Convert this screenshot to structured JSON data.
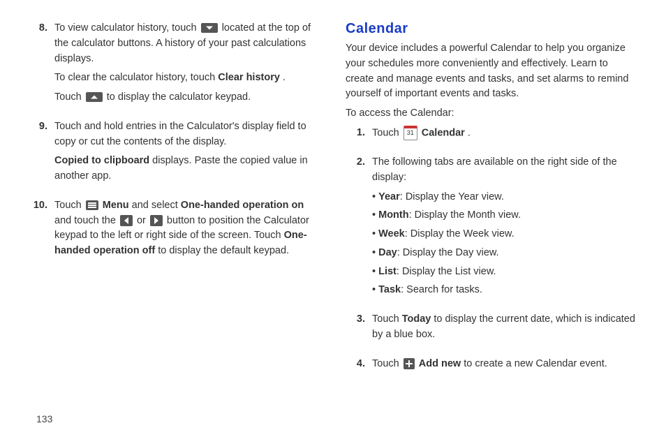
{
  "page_number": "133",
  "left": {
    "step8": {
      "num": "8.",
      "p1_a": "To view calculator history, touch ",
      "p1_b": " located at the top of the calculator buttons. A history of your past calculations displays.",
      "p2_a": "To clear the calculator history, touch ",
      "p2_b": "Clear history",
      "p2_c": ".",
      "p3_a": "Touch ",
      "p3_b": " to display the calculator keypad."
    },
    "step9": {
      "num": "9.",
      "p1": "Touch and hold entries in the Calculator's display field to copy or cut the contents of the display.",
      "p2_a": "Copied to clipboard",
      "p2_b": " displays. Paste the copied value in another app."
    },
    "step10": {
      "num": "10.",
      "p1_a": "Touch ",
      "p1_b": " Menu",
      "p1_c": " and select ",
      "p1_d": "One-handed operation on",
      "p1_e": " and touch the ",
      "p1_f": " or ",
      "p1_g": " button to position the Calculator keypad to the left or right side of the screen. Touch ",
      "p1_h": "One-handed operation off",
      "p1_i": " to display the default keypad."
    }
  },
  "right": {
    "heading": "Calendar",
    "intro": "Your device includes a powerful Calendar to help you organize your schedules more conveniently and effectively. Learn to create and manage events and tasks, and set alarms to remind yourself of important events and tasks.",
    "access": "To access the Calendar:",
    "cal_date": "31",
    "step1": {
      "num": "1.",
      "a": "Touch ",
      "b": " Calendar",
      "c": "."
    },
    "step2": {
      "num": "2.",
      "intro": "The following tabs are available on the right side of the display:",
      "bullets": [
        {
          "label": "Year",
          "text": ": Display the Year view."
        },
        {
          "label": "Month",
          "text": ": Display the Month view."
        },
        {
          "label": "Week",
          "text": ": Display the Week view."
        },
        {
          "label": "Day",
          "text": ": Display the Day view."
        },
        {
          "label": "List",
          "text": ": Display the List view."
        },
        {
          "label": "Task",
          "text": ": Search for tasks."
        }
      ]
    },
    "step3": {
      "num": "3.",
      "a": "Touch ",
      "b": "Today",
      "c": " to display the current date, which is indicated by a blue box."
    },
    "step4": {
      "num": "4.",
      "a": "Touch ",
      "b": " Add new",
      "c": " to create a new Calendar event."
    }
  }
}
